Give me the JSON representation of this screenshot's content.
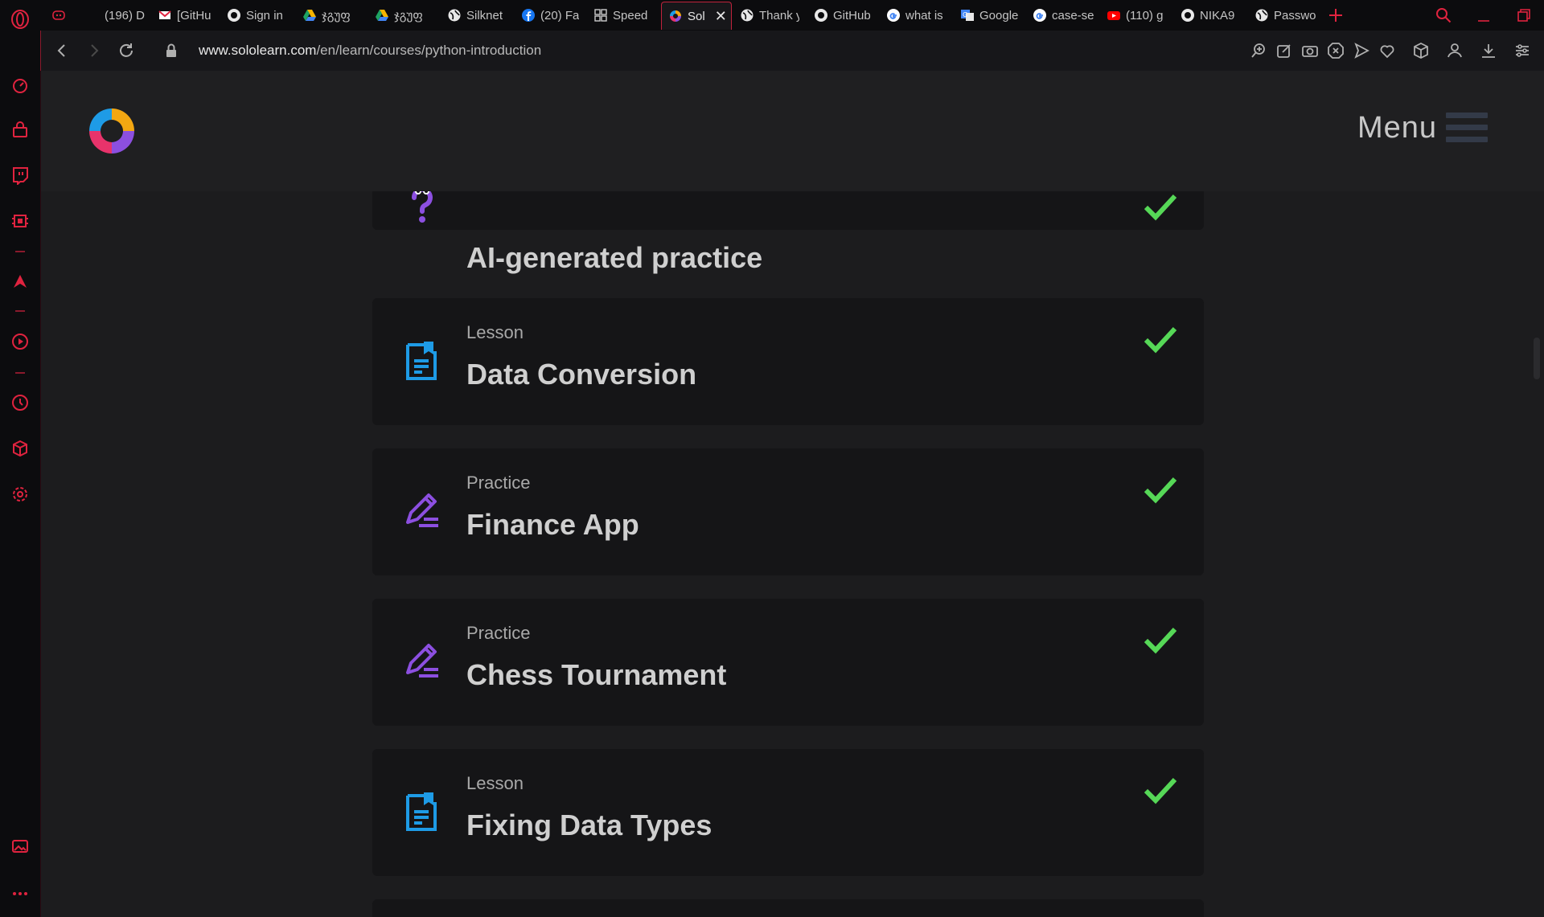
{
  "browser": {
    "tabs": [
      {
        "label": "(196) D",
        "favicon": "discord-icon"
      },
      {
        "label": "[GitHu",
        "favicon": "gmail-icon"
      },
      {
        "label": "Sign in",
        "favicon": "github-icon"
      },
      {
        "label": "ჯგუფ",
        "favicon": "google-drive-icon"
      },
      {
        "label": "ჯგუფ",
        "favicon": "google-drive-icon"
      },
      {
        "label": "Silknet",
        "favicon": "globe-icon"
      },
      {
        "label": "(20) Fa",
        "favicon": "facebook-icon"
      },
      {
        "label": "Speed",
        "favicon": "speed-dial-icon"
      },
      {
        "label": "Sol",
        "favicon": "sololearn-icon",
        "active": true
      },
      {
        "label": "Thank y",
        "favicon": "globe-icon"
      },
      {
        "label": "GitHub",
        "favicon": "github-icon"
      },
      {
        "label": "what is",
        "favicon": "google-icon"
      },
      {
        "label": "Google",
        "favicon": "google-translate-icon"
      },
      {
        "label": "case-se",
        "favicon": "google-icon"
      },
      {
        "label": "(110) g",
        "favicon": "youtube-icon"
      },
      {
        "label": "NIKA9",
        "favicon": "github-icon"
      },
      {
        "label": "Passwo",
        "favicon": "globe-icon"
      }
    ],
    "url_domain": "www.sololearn.com",
    "url_path": "/en/learn/courses/python-introduction",
    "accent_color": "#e0233f"
  },
  "site": {
    "menu_label": "Menu"
  },
  "cards": [
    {
      "type": "",
      "title": "AI-generated practice",
      "icon": "question-mark-icon",
      "completed": true
    },
    {
      "type": "Lesson",
      "title": "Data Conversion",
      "icon": "lesson-document-icon",
      "completed": true
    },
    {
      "type": "Practice",
      "title": "Finance App",
      "icon": "practice-pencil-icon",
      "completed": true
    },
    {
      "type": "Practice",
      "title": "Chess Tournament",
      "icon": "practice-pencil-icon",
      "completed": true
    },
    {
      "type": "Lesson",
      "title": "Fixing Data Types",
      "icon": "lesson-document-icon",
      "completed": true
    }
  ],
  "colors": {
    "check_green": "#56d857",
    "lesson_blue": "#1e9be6",
    "practice_purple": "#8c4fe0"
  }
}
